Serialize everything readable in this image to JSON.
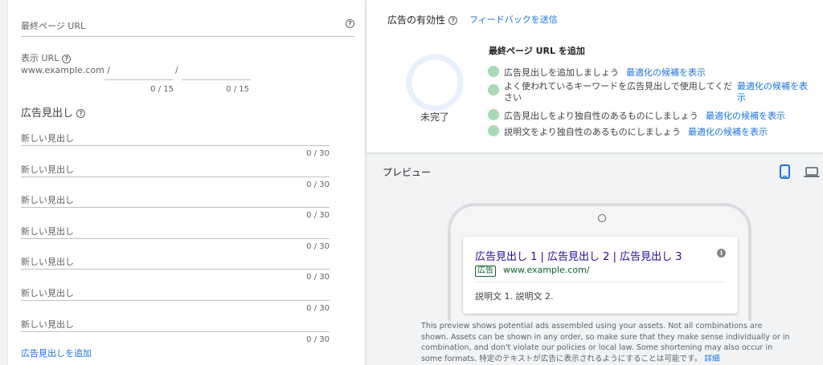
{
  "form": {
    "final_url_placeholder": "最終ページ URL",
    "display_url_label": "表示 URL",
    "display_url_base": "www.example.com /",
    "path_separator": "/",
    "path1_counter": "0 / 15",
    "path2_counter": "0 / 15",
    "headlines_title": "広告見出し",
    "headlines": [
      {
        "placeholder": "新しい見出し",
        "counter": "0 / 30"
      },
      {
        "placeholder": "新しい見出し",
        "counter": "0 / 30"
      },
      {
        "placeholder": "新しい見出し",
        "counter": "0 / 30"
      },
      {
        "placeholder": "新しい見出し",
        "counter": "0 / 30"
      },
      {
        "placeholder": "新しい見出し",
        "counter": "0 / 30"
      },
      {
        "placeholder": "新しい見出し",
        "counter": "0 / 30"
      },
      {
        "placeholder": "新しい見出し",
        "counter": "0 / 30"
      }
    ],
    "add_headline_label": "広告見出しを追加"
  },
  "strength": {
    "title": "広告の有効性",
    "feedback_link": "フィードバックを送信",
    "status": "未完了",
    "suggestions_title": "最終ページ URL を追加",
    "suggestions": [
      {
        "text": "広告見出しを追加しましょう",
        "link": "最適化の候補を表示"
      },
      {
        "text": "よく使われているキーワードを広告見出しで使用してください",
        "link": "最適化の候補を表示"
      },
      {
        "text": "広告見出しをより独自性のあるものにしましょう",
        "link": "最適化の候補を表示"
      },
      {
        "text": "説明文をより独自性のあるものにしましょう",
        "link": "最適化の候補を表示"
      }
    ]
  },
  "preview": {
    "title": "プレビュー",
    "ad_headline": "広告見出し 1 | 広告見出し 2 | 広告見出し 3",
    "ad_badge": "広告",
    "ad_url": "www.example.com/",
    "ad_description": "説明文 1. 説明文 2.",
    "disclaimer": "This preview shows potential ads assembled using your assets. Not all combinations are shown. Assets can be shown in any order, so make sure that they make sense individually or in combination, and don't violate our policies or local law. Some shortening may also occur in some formats. 特定のテキストが広告に表示されるようにすることは可能です。",
    "disclaimer_link": "詳細"
  },
  "colors": {
    "accent": "#1a73e8",
    "suggestion_dot": "#a8dab5",
    "ring": "#e8f0fe"
  }
}
